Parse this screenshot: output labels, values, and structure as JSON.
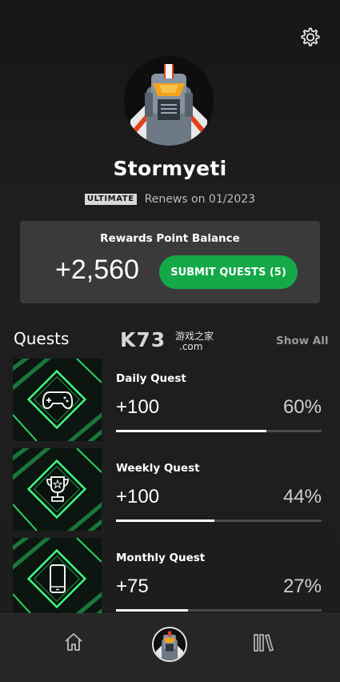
{
  "header": {
    "settings_icon": "gear-icon"
  },
  "profile": {
    "avatar_icon": "robot-helmet-avatar",
    "username": "Stormyeti",
    "membership_badge": "ULTIMATE",
    "renews_text": "Renews on 01/2023"
  },
  "rewards": {
    "title": "Rewards Point Balance",
    "points": "+2,560",
    "submit_label": "SUBMIT QUESTS (5)",
    "accent_color": "#14a847"
  },
  "quests": {
    "title": "Quests",
    "show_all_label": "Show All",
    "watermark": {
      "brand": "K73",
      "chinese": "游戏之家",
      "domain": ".com"
    },
    "items": [
      {
        "name": "Daily Quest",
        "points": "+100",
        "percent_label": "60%",
        "progress": 0.73,
        "icon": "gamepad-icon"
      },
      {
        "name": "Weekly Quest",
        "points": "+100",
        "percent_label": "44%",
        "progress": 0.48,
        "icon": "trophy-icon"
      },
      {
        "name": "Monthly Quest",
        "points": "+75",
        "percent_label": "27%",
        "progress": 0.35,
        "icon": "phone-icon"
      }
    ]
  },
  "bottom_nav": {
    "items": [
      {
        "icon": "home-icon"
      },
      {
        "icon": "profile-avatar-icon"
      },
      {
        "icon": "library-icon"
      }
    ]
  }
}
